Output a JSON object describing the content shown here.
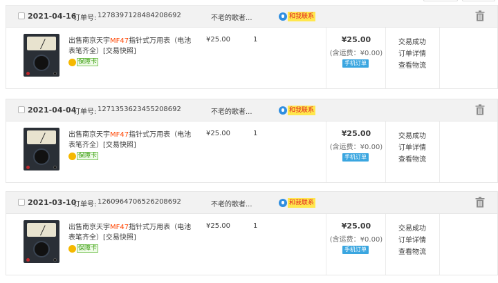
{
  "labels": {
    "order_no_label": "订单号:",
    "chat": "和我联系",
    "badge": "保障卡",
    "mobile_order": "手机订单",
    "status": "交易成功",
    "detail": "订单详情",
    "logistics": "查看物流"
  },
  "orders": [
    {
      "date": "2021-04-16",
      "order_no": "1278397128484208692",
      "seller": "不老的歌者...",
      "title_pre": "出售南京天宇",
      "title_hl": "MF47",
      "title_post": "指针式万用表（电池表笔齐全）[交易快照]",
      "unit_price": "¥25.00",
      "qty": "1",
      "total": "¥25.00",
      "shipping": "(含运费：¥0.00)"
    },
    {
      "date": "2021-04-04",
      "order_no": "1271353623455208692",
      "seller": "不老的歌者...",
      "title_pre": "出售南京天宇",
      "title_hl": "MF47",
      "title_post": "指针式万用表（电池表笔齐全）[交易快照]",
      "unit_price": "¥25.00",
      "qty": "1",
      "total": "¥25.00",
      "shipping": "(含运费：¥0.00)"
    },
    {
      "date": "2021-03-10",
      "order_no": "1260964706526208692",
      "seller": "不老的歌者...",
      "title_pre": "出售南京天宇",
      "title_hl": "MF47",
      "title_post": "指针式万用表（电池表笔齐全）[交易快照]",
      "unit_price": "¥25.00",
      "qty": "1",
      "total": "¥25.00",
      "shipping": "(含运费：¥0.00)"
    }
  ],
  "icons": {
    "checkbox": "checkbox-icon",
    "chat": "chat-bubble-icon",
    "badge": "shield-badge-icon",
    "trash": "trash-icon"
  },
  "colors": {
    "highlight": "#ff4400",
    "chat_bg": "#ffe74d",
    "chat_text": "#e02020",
    "mobile_tag": "#3aa6e0",
    "badge_green": "#3b9d10",
    "header_bg": "#f2f2f2"
  }
}
